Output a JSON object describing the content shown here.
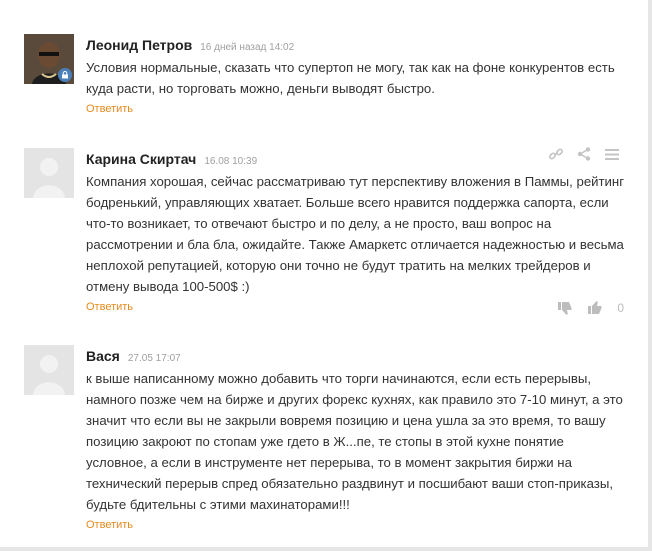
{
  "comments": [
    {
      "author": "Леонид Петров",
      "date": "16 дней назад 14:02",
      "text": "Условия нормальные, сказать что супертоп не могу, так как на фоне конкурентов есть куда расти, но торговать можно, деньги выводят быстро.",
      "reply_label": "Ответить"
    },
    {
      "author": "Карина Скиртач",
      "date": "16.08 10:39",
      "text": "Компания хорошая, сейчас рассматриваю тут перспективу вложения в Паммы, рейтинг бодренький, управляющих хватает. Больше всего нравится поддержка сапорта, если что-то возникает, то отвечают быстро и по делу, а не просто, ваш вопрос на рассмотрении и бла бла, ожидайте. Также Амаркетс отличается надежностью и весьма неплохой репутацией, которую они точно не будут тратить на мелких трейдеров и отмену вывода 100-500$ :)",
      "reply_label": "Ответить",
      "vote_count": "0"
    },
    {
      "author": "Вася",
      "date": "27.05 17:07",
      "text": "к выше написанному можно добавить что торги начинаются, если есть перерывы, намного позже чем на бирже и других форекс кухнях, как правило это 7-10 минут, а это значит что если вы не закрыли вовремя позицию и цена ушла за это время, то вашу позицию закроют по стопам уже гдето в Ж...пе, те стопы в этой кухне понятие условное, а если в инструменте нет перерыва, то в момент закрытия биржи на технический перерыв спред обязательно раздвинут и посшибают ваши стоп-приказы, будьте бдительны с этими махинаторами!!!",
      "reply_label": "Ответить"
    }
  ],
  "icons": {
    "link": "link-icon",
    "share": "share-icon",
    "menu": "menu-icon",
    "dislike": "thumbs-down-icon",
    "like": "thumbs-up-icon",
    "badge": "lock-badge-icon"
  },
  "colors": {
    "reply": "#e48a1c",
    "author": "#222222",
    "date": "#a0a0a0",
    "avatar_placeholder": "#e4e4e4"
  }
}
